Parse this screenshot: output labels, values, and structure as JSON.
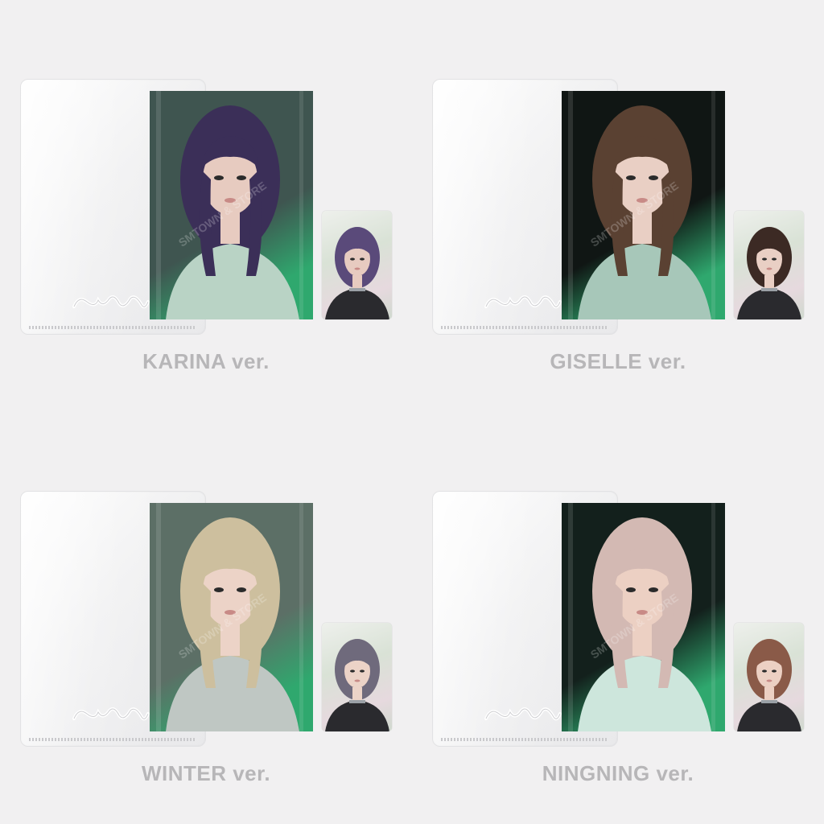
{
  "versions": [
    {
      "label": "KARINA ver.",
      "hair": "#3b2f58",
      "skin": "#e7cbc0",
      "outfit": "#b9d3c5",
      "bg": "#3f5550",
      "card_hair": "#5a4a7a"
    },
    {
      "label": "GISELLE ver.",
      "hair": "#5a4132",
      "skin": "#e9cfc4",
      "outfit": "#a7c7b9",
      "bg": "#101614",
      "card_hair": "#3c2a24"
    },
    {
      "label": "WINTER ver.",
      "hair": "#cdbf9e",
      "skin": "#ecd3c7",
      "outfit": "#bfc7c3",
      "bg": "#5c6f66",
      "card_hair": "#6f6a7c"
    },
    {
      "label": "NINGNING ver.",
      "hair": "#d3b9b3",
      "skin": "#ecd0c3",
      "outfit": "#cde6dc",
      "bg": "#13201c",
      "card_hair": "#8a5a48"
    }
  ],
  "watermark": {
    "text": "SMTOWN & STORE"
  },
  "colors": {
    "background": "#f1f0f1",
    "caption": "#b7b6b8",
    "accent_green": "#2fa86e"
  }
}
